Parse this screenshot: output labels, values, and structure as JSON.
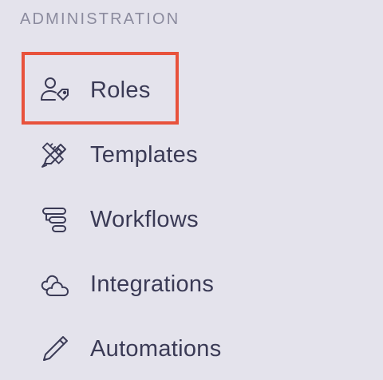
{
  "section": {
    "heading": "ADMINISTRATION"
  },
  "nav": {
    "items": [
      {
        "label": "Roles",
        "icon": "user-tag-icon"
      },
      {
        "label": "Templates",
        "icon": "pencil-ruler-icon"
      },
      {
        "label": "Workflows",
        "icon": "workflow-icon"
      },
      {
        "label": "Integrations",
        "icon": "cloud-icon"
      },
      {
        "label": "Automations",
        "icon": "pen-icon"
      }
    ]
  },
  "highlight": {
    "color": "#e8523c",
    "target": "Roles"
  },
  "colors": {
    "background": "#e4e3ec",
    "text": "#3a3a55",
    "heading": "#8b8b9e"
  }
}
